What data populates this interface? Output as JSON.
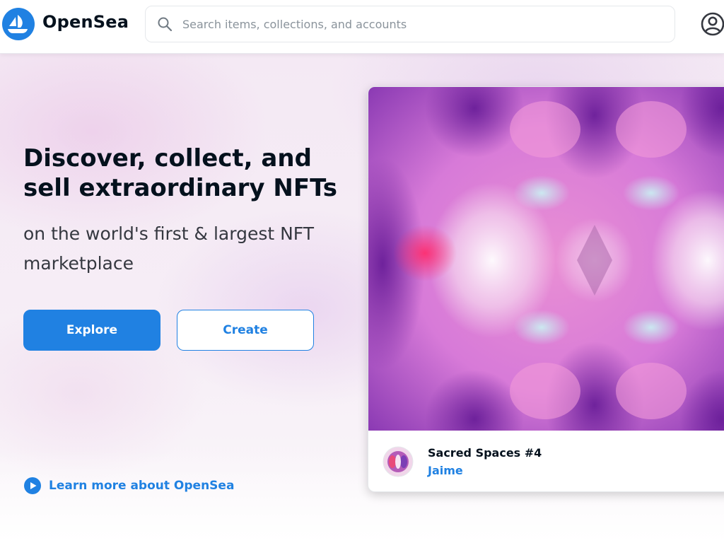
{
  "header": {
    "brand": "OpenSea",
    "search_placeholder": "Search items, collections, and accounts"
  },
  "hero": {
    "headline": "Discover, collect, and sell extraordinary NFTs",
    "subline": "on the world's first & largest NFT marketplace",
    "explore_label": "Explore",
    "create_label": "Create",
    "learn_more_label": "Learn more about OpenSea"
  },
  "featured": {
    "title": "Sacred Spaces #4",
    "creator": "Jaime"
  },
  "icons": {
    "logo": "opensea-logo-icon",
    "search": "search-icon",
    "account": "account-icon",
    "play": "play-circle-icon"
  },
  "colors": {
    "accent": "#2081e2",
    "text_dark": "#04111d",
    "text_muted": "#8a939b"
  }
}
